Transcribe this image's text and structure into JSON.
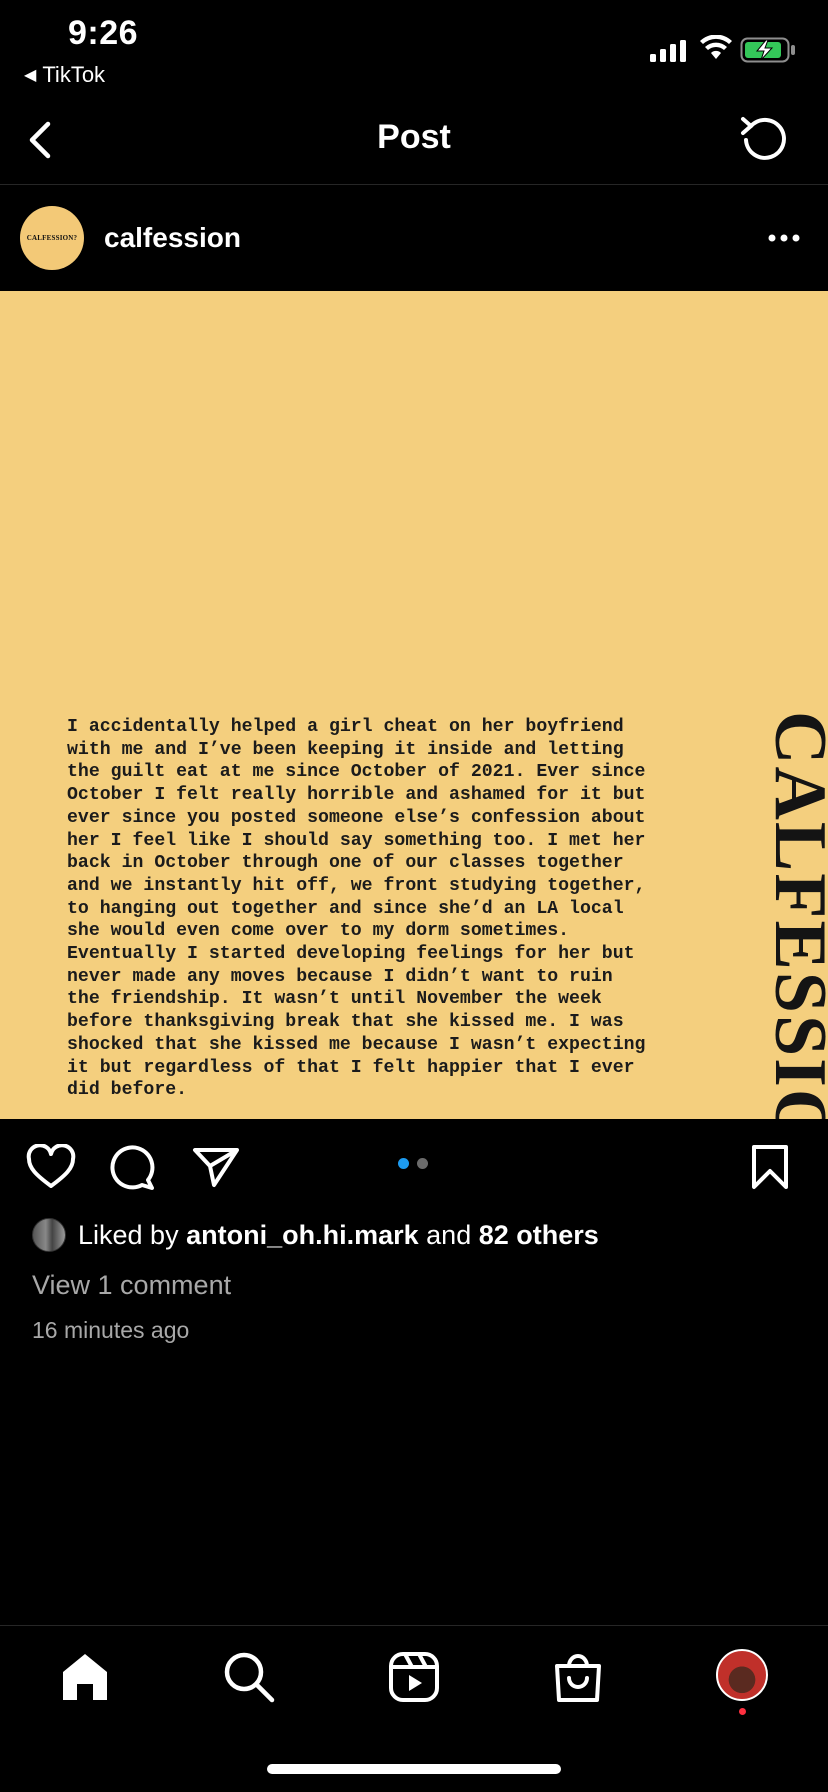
{
  "status_bar": {
    "time": "9:26",
    "back_app": "TikTok",
    "back_arrow": "◀"
  },
  "header": {
    "title": "Post",
    "back_icon": "chevron-left-icon",
    "refresh_icon": "refresh-icon"
  },
  "post": {
    "username": "calfession",
    "avatar_text": "CALFESSION?",
    "brand_vertical": "CALFESSION?",
    "confession_text": "I accidentally helped a girl cheat on her boyfriend\nwith me and I’ve been keeping it inside and letting\nthe guilt eat at me since October of 2021. Ever since\nOctober I felt really horrible and ashamed for it but\never since you posted someone else’s confession about\nher I feel like I should say something too. I met her\nback in October through one of our classes together\nand we instantly hit off, we front studying together,\nto hanging out together and since she’d an LA local\nshe would even come over to my dorm sometimes.\nEventually I started developing feelings for her but\nnever made any moves because I didn’t want to ruin\nthe friendship. It wasn’t until November the week\nbefore thanksgiving break that she kissed me. I was\nshocked that she kissed me because I wasn’t expecting\nit but regardless of that I felt happier that I ever\ndid before.",
    "image_bg": "#f4cf7e",
    "carousel": {
      "total": 2,
      "active": 1
    },
    "likes": {
      "prefix": "Liked by",
      "user": "antoni_oh.hi.mark",
      "conj": "and",
      "others": "82 others"
    },
    "view_comments": "View 1 comment",
    "time_ago": "16 minutes ago"
  },
  "nav": {
    "items": [
      "home-icon",
      "search-icon",
      "reels-icon",
      "shop-icon",
      "profile-avatar"
    ]
  },
  "colors": {
    "accent": "#1d9bf0",
    "notification": "#ff3040",
    "background": "#000000"
  }
}
